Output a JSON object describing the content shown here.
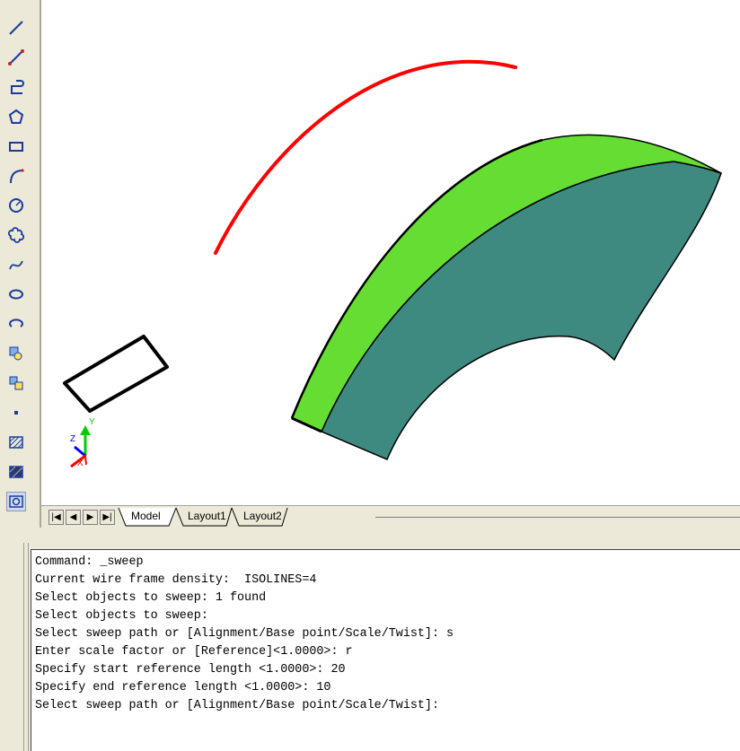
{
  "toolbar": {
    "tools": [
      {
        "name": "line-icon"
      },
      {
        "name": "construction-line-icon"
      },
      {
        "name": "polyline-icon"
      },
      {
        "name": "polygon-icon"
      },
      {
        "name": "rectangle-icon"
      },
      {
        "name": "arc-icon"
      },
      {
        "name": "circle-icon"
      },
      {
        "name": "revision-cloud-icon"
      },
      {
        "name": "spline-icon"
      },
      {
        "name": "ellipse-icon"
      },
      {
        "name": "ellipse-arc-icon"
      },
      {
        "name": "insert-block-icon"
      },
      {
        "name": "make-block-icon"
      },
      {
        "name": "point-icon"
      },
      {
        "name": "hatch-icon"
      },
      {
        "name": "gradient-icon"
      },
      {
        "name": "region-icon"
      }
    ]
  },
  "viewport": {
    "colors": {
      "path_arc": "#ff0000",
      "solid_top": "#66dd33",
      "solid_side": "#3e8a80",
      "profile": "#000000",
      "ucs_x": "#ff0000",
      "ucs_y": "#00cc00",
      "ucs_z": "#0000ff"
    },
    "ucs_labels": {
      "y": "Y",
      "z": "Z",
      "x": "X"
    }
  },
  "tabs": {
    "nav": [
      "first-tab",
      "previous-tab",
      "next-tab",
      "last-tab"
    ],
    "items": [
      {
        "label": "Model",
        "active": true
      },
      {
        "label": "Layout1",
        "active": false
      },
      {
        "label": "Layout2",
        "active": false
      }
    ]
  },
  "command": {
    "lines": [
      "Command: _sweep",
      "Current wire frame density:  ISOLINES=4",
      "Select objects to sweep: 1 found",
      "Select objects to sweep:",
      "Select sweep path or [Alignment/Base point/Scale/Twist]: s",
      "Enter scale factor or [Reference]<1.0000>: r",
      "Specify start reference length <1.0000>: 20",
      "Specify end reference length <1.0000>: 10",
      "Select sweep path or [Alignment/Base point/Scale/Twist]:"
    ]
  }
}
